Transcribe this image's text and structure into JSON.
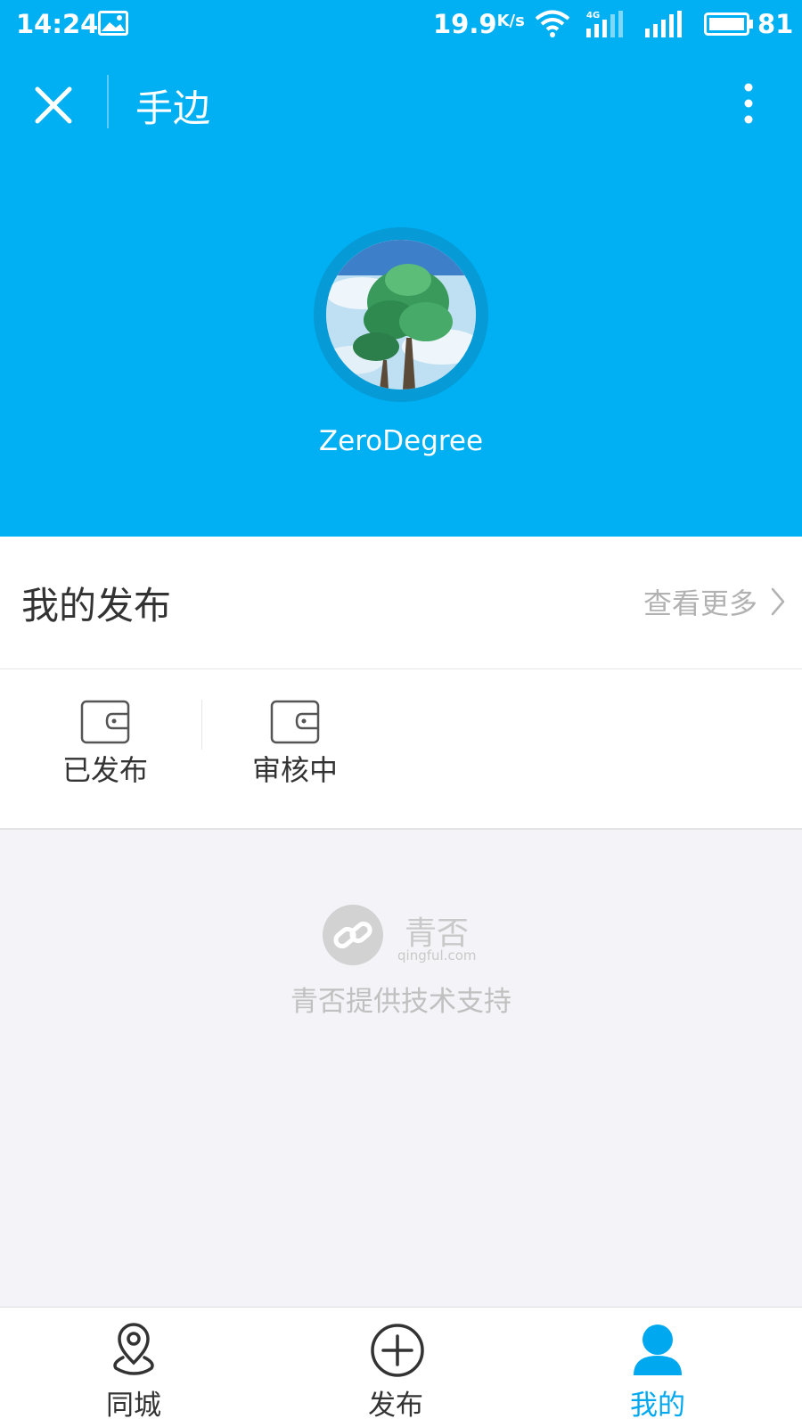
{
  "status_bar": {
    "time": "14:24",
    "speed": "19.9",
    "speed_unit": "K/s",
    "network": "4G",
    "battery": "81"
  },
  "navbar": {
    "title": "手边",
    "close_icon": "close-icon",
    "more_icon": "more-vertical-icon"
  },
  "profile": {
    "username": "ZeroDegree",
    "avatar_icon": "tree-avatar"
  },
  "my_posts": {
    "title": "我的发布",
    "see_more": "查看更多"
  },
  "tabs": [
    {
      "label": "已发布",
      "icon": "wallet-icon"
    },
    {
      "label": "审核中",
      "icon": "wallet-icon"
    }
  ],
  "powered_by": {
    "brand": "青否",
    "domain": "qingful.com",
    "text": "青否提供技术支持"
  },
  "bottom_nav": [
    {
      "label": "同城",
      "icon": "location-pin-icon",
      "active": false
    },
    {
      "label": "发布",
      "icon": "plus-circle-icon",
      "active": false
    },
    {
      "label": "我的",
      "icon": "person-icon",
      "active": true
    }
  ],
  "colors": {
    "primary": "#00b0f2",
    "active": "#00a8f0",
    "muted_text": "#b2b2b2"
  }
}
